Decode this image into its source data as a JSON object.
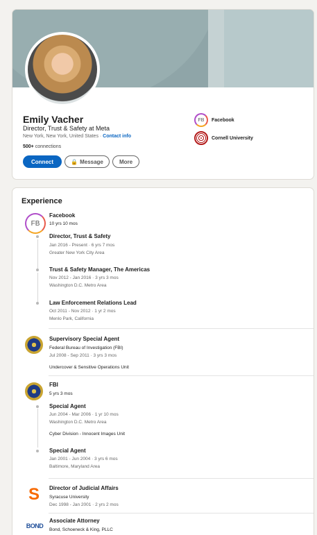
{
  "profile": {
    "name": "Emily Vacher",
    "headline": "Director, Trust & Safety at Meta",
    "location": "New York, New York, United States · ",
    "contact_info": "Contact info",
    "connections_count": "500+",
    "connections_label": " connections",
    "buttons": {
      "connect": "Connect",
      "message": "Message",
      "more": "More"
    },
    "side": [
      {
        "logo": "FB",
        "label": "Facebook"
      },
      {
        "label": "Cornell University"
      }
    ]
  },
  "experience": {
    "title": "Experience",
    "facebook": {
      "logo": "FB",
      "company": "Facebook",
      "duration": "10 yrs 10 mos",
      "roles": [
        {
          "title": "Director, Trust & Safety",
          "dates": "Jan 2016 - Present · 6 yrs 7 mos",
          "location": "Greater New York City Area"
        },
        {
          "title": "Trust & Safety Manager, The Americas",
          "dates": "Nov 2012 - Jan 2016 · 3 yrs 3 mos",
          "location": "Washington D.C. Metro Area"
        },
        {
          "title": "Law Enforcement Relations Lead",
          "dates": "Oct 2011 - Nov 2012 · 1 yr 2 mos",
          "location": "Menlo Park, California"
        }
      ]
    },
    "fbi_ssa": {
      "title": "Supervisory Special Agent",
      "org": "Federal Bureau of Investigation (FBI)",
      "dates": "Jul 2008 - Sep 2011 · 3 yrs 3 mos",
      "desc": "Undercover & Sensitive Operations Unit"
    },
    "fbi": {
      "company": "FBI",
      "duration": "5 yrs 3 mos",
      "roles": [
        {
          "title": "Special Agent",
          "dates": "Jun 2004 - Mar 2006 · 1 yr 10 mos",
          "location": "Washington D.C. Metro Area",
          "desc": "Cyber Division - Innocent Images Unit"
        },
        {
          "title": "Special Agent",
          "dates": "Jan 2001 - Jun 2004 · 3 yrs 6 mos",
          "location": "Baltimore, Maryland Area"
        }
      ]
    },
    "syracuse": {
      "logo": "S",
      "title": "Director of Judicial Affairs",
      "org": "Syracuse University",
      "dates": "Dec 1998 - Jan 2001 · 2 yrs 2 mos"
    },
    "bond": {
      "logo": "BOND",
      "title": "Associate Attorney",
      "org": "Bond, Schoeneck & King, PLLC"
    }
  },
  "colors": {
    "accent": "#0a66c2",
    "banner": "#8fa5a8",
    "page_bg": "#f3f2ef"
  }
}
